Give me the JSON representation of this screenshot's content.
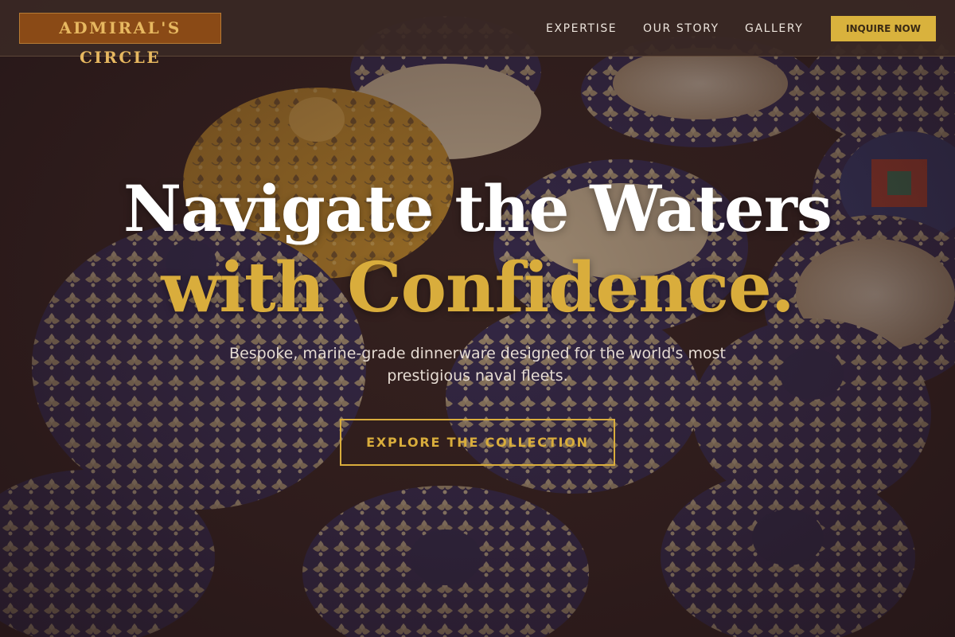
{
  "header": {
    "logo_text": "ADMIRAL'S CIRCLE",
    "nav": [
      {
        "label": "EXPERTISE"
      },
      {
        "label": "OUR STORY"
      },
      {
        "label": "GALLERY"
      }
    ],
    "cta_label": "INQUIRE NOW"
  },
  "hero": {
    "headline": "Navigate the Waters",
    "headline_accent": "with Confidence.",
    "subtext": "Bespoke, marine-grade dinnerware designed for the world's most prestigious naval fleets.",
    "button_label": "EXPLORE THE COLLECTION",
    "background_image": "pottery-photo"
  },
  "colors": {
    "accent_gold": "#d9ad3c",
    "logo_bg": "#8a4a16",
    "header_bg": "#3a2824",
    "hero_overlay": "#2d1a19"
  }
}
